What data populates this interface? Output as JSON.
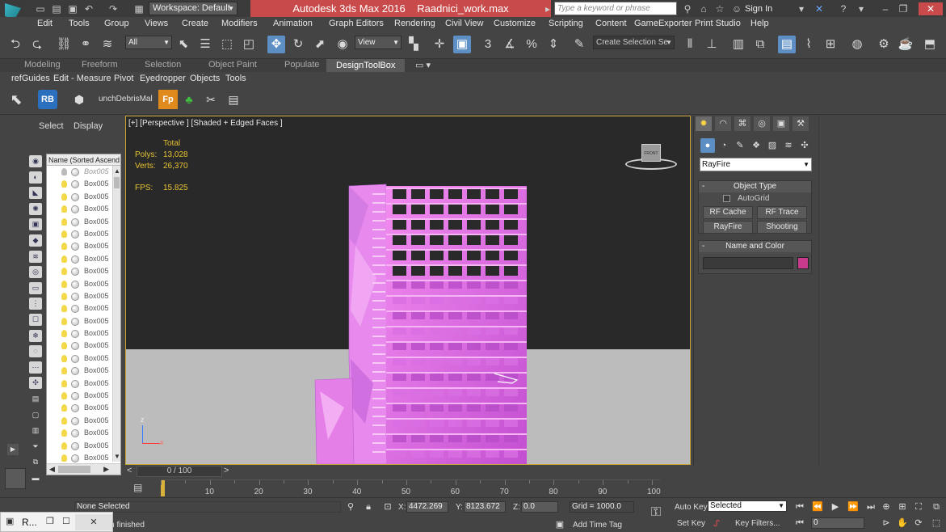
{
  "window": {
    "app_title": "Autodesk 3ds Max 2016",
    "file_name": "Raadnici_work.max",
    "workspace": "Workspace: Default",
    "search_placeholder": "Type a keyword or phrase",
    "signin": "Sign In"
  },
  "menu": [
    "Edit",
    "Tools",
    "Group",
    "Views",
    "Create",
    "Modifiers",
    "Animation",
    "Graph Editors",
    "Rendering",
    "Civil View",
    "Customize",
    "Scripting",
    "Content",
    "GameExporter",
    "Print Studio",
    "Help"
  ],
  "toolbar": {
    "filter": "All",
    "coord_system": "View",
    "selection_set_placeholder": "Create Selection Se",
    "snap_3": "3",
    "percent_snap": "%"
  },
  "ribbon_tabs": [
    "Modeling",
    "Freeform",
    "Selection",
    "Object Paint",
    "Populate",
    "DesignToolBox"
  ],
  "ribbon_active": "DesignToolBox",
  "submenu": [
    "refGuides",
    "Edit - Measure",
    "Pivot",
    "Eyedropper",
    "Objects",
    "Tools"
  ],
  "toolbar2": {
    "rb_label": "RB",
    "debris_label": "unchDebrisMal",
    "fp_label": "Fp"
  },
  "explorer": {
    "tabs": [
      "Select",
      "Display"
    ],
    "column_header": "Name (Sorted Ascend",
    "rows": [
      "Box005",
      "Box005",
      "Box005",
      "Box005",
      "Box005",
      "Box005",
      "Box005",
      "Box005",
      "Box005",
      "Box005",
      "Box005",
      "Box005",
      "Box005",
      "Box005",
      "Box005",
      "Box005",
      "Box005",
      "Box005",
      "Box005",
      "Box005",
      "Box005",
      "Box005",
      "Box005",
      "Box005",
      "Box005"
    ]
  },
  "viewport": {
    "label": "[+] [Perspective ] [Shaded + Edged Faces ]",
    "stats_total": "Total",
    "polys_label": "Polys:",
    "polys_value": "13,028",
    "verts_label": "Verts:",
    "verts_value": "26,370",
    "fps_label": "FPS:",
    "fps_value": "15.825",
    "viewcube_label": "FRONT",
    "axis_z": "z",
    "axis_x": "x"
  },
  "time": {
    "frame_display": "0 / 100",
    "ticks": [
      "10",
      "20",
      "30",
      "40",
      "50",
      "60",
      "70",
      "80",
      "90",
      "100"
    ]
  },
  "command_panel": {
    "category": "RayFire",
    "object_type_title": "Object Type",
    "autogrid": "AutoGrid",
    "buttons": [
      "RF Cache",
      "RF Trace",
      "RayFire",
      "Shooting"
    ],
    "name_color_title": "Name and Color",
    "name_value": "",
    "swatch_color": "#c83a8c"
  },
  "status": {
    "none_selected": "None Selected",
    "prompt": "ation finished",
    "x_label": "X:",
    "x_value": "4472.269",
    "y_label": "Y:",
    "y_value": "8123.672",
    "z_label": "Z:",
    "z_value": "0.0",
    "grid": "Grid = 1000.0",
    "add_time_tag": "Add Time Tag",
    "auto_key": "Auto Key",
    "set_key": "Set Key",
    "selected_dropdown": "Selected",
    "key_filters": "Key Filters...",
    "frame_field": "0"
  },
  "taskbar": {
    "app_letter": "R..."
  },
  "colors": {
    "title_accent": "#c84a4a",
    "viewport_border": "#c9a63a",
    "stats_text": "#e6c232",
    "active_blue": "#5d8fc4",
    "building_magenta": "#e070e8"
  }
}
